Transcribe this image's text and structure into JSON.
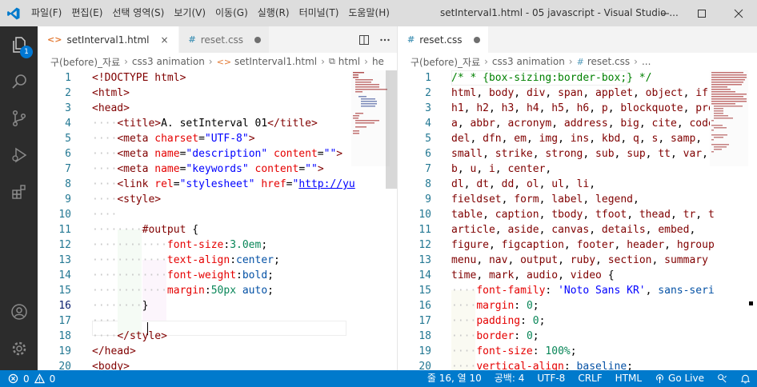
{
  "menu": [
    "파일(F)",
    "편집(E)",
    "선택 영역(S)",
    "보기(V)",
    "이동(G)",
    "실행(R)",
    "터미널(T)",
    "도움말(H)"
  ],
  "window_title": "setInterval1.html - 05 javascript - Visual Studio ...",
  "explorer_badge": "1",
  "left": {
    "tabs": [
      {
        "label": "setInterval1.html",
        "icon": "<>",
        "state": "active",
        "close": "×"
      },
      {
        "label": "reset.css",
        "icon": "#",
        "state": "inactive"
      }
    ],
    "breadcrumb": [
      "구(before)_자료",
      "css3 animation",
      "setInterval1.html",
      "html",
      "he"
    ],
    "lines": [
      {
        "n": "1",
        "html": "<span class=\"t-tag\">&lt;!DOCTYPE html&gt;</span>"
      },
      {
        "n": "2",
        "html": "<span class=\"t-tag\">&lt;html&gt;</span>"
      },
      {
        "n": "3",
        "html": "<span class=\"t-tag\">&lt;head&gt;</span>"
      },
      {
        "n": "4",
        "html": "<span class=\"t-dim\">····</span><span class=\"t-tag\">&lt;title&gt;</span>A. setInterval 01<span class=\"t-tag\">&lt;/title&gt;</span>"
      },
      {
        "n": "5",
        "html": "<span class=\"t-dim\">····</span><span class=\"t-tag\">&lt;meta</span> <span class=\"t-attr\">charset</span>=<span class=\"t-str\">\"UTF-8\"</span><span class=\"t-tag\">&gt;</span>"
      },
      {
        "n": "6",
        "html": "<span class=\"t-dim\">····</span><span class=\"t-tag\">&lt;meta</span> <span class=\"t-attr\">name</span>=<span class=\"t-str\">\"description\"</span> <span class=\"t-attr\">content</span>=<span class=\"t-str\">\"\"</span><span class=\"t-tag\">&gt;</span>"
      },
      {
        "n": "7",
        "html": "<span class=\"t-dim\">····</span><span class=\"t-tag\">&lt;meta</span> <span class=\"t-attr\">name</span>=<span class=\"t-str\">\"keywords\"</span> <span class=\"t-attr\">content</span>=<span class=\"t-str\">\"\"</span><span class=\"t-tag\">&gt;</span>"
      },
      {
        "n": "8",
        "html": "<span class=\"t-dim\">····</span><span class=\"t-tag\">&lt;link</span> <span class=\"t-attr\">rel</span>=<span class=\"t-str\">\"stylesheet\"</span> <span class=\"t-attr\">href</span>=<span class=\"t-str\">\"<span class=\"t-link\">http://yu</span></span>"
      },
      {
        "n": "9",
        "html": "<span class=\"t-dim\">····</span><span class=\"t-tag\">&lt;style&gt;</span>"
      },
      {
        "n": "10",
        "html": "<span class=\"t-dim\">····</span>"
      },
      {
        "n": "11",
        "html": "<span class=\"t-dim\">········</span><span class=\"t-sel\">#output</span> {"
      },
      {
        "n": "12",
        "html": "<span class=\"t-dim\">············</span><span class=\"t-prop\">font-size</span>:<span class=\"t-num\">3.0em</span>;"
      },
      {
        "n": "13",
        "html": "<span class=\"t-dim\">············</span><span class=\"t-prop\">text-align</span>:<span class=\"t-val\">center</span>;"
      },
      {
        "n": "14",
        "html": "<span class=\"t-dim\">············</span><span class=\"t-prop\">font-weight</span>:<span class=\"t-val\">bold</span>;"
      },
      {
        "n": "15",
        "html": "<span class=\"t-dim\">············</span><span class=\"t-prop\">margin</span>:<span class=\"t-num\">50px</span> <span class=\"t-val\">auto</span>;"
      },
      {
        "n": "16",
        "html": "<span class=\"t-dim\">········</span>}",
        "current": true
      },
      {
        "n": "17",
        "html": "<span class=\"t-dim\">····</span>"
      },
      {
        "n": "18",
        "html": "<span class=\"t-dim\">····</span><span class=\"t-tag\">&lt;/style&gt;</span>"
      },
      {
        "n": "19",
        "html": "<span class=\"t-tag\">&lt;/head&gt;</span>"
      },
      {
        "n": "20",
        "html": "<span class=\"t-tag\">&lt;body&gt;</span>"
      }
    ]
  },
  "right": {
    "tabs": [
      {
        "label": "reset.css",
        "icon": "#",
        "state": "active",
        "dirty": true
      }
    ],
    "breadcrumb": [
      "구(before)_자료",
      "css3 animation",
      "reset.css",
      "..."
    ],
    "lines": [
      {
        "n": "1",
        "html": "<span class=\"t-com\">/* * {box-sizing:border-box;} */</span>"
      },
      {
        "n": "2",
        "html": "<span class=\"t-sel\">html</span>, <span class=\"t-sel\">body</span>, <span class=\"t-sel\">div</span>, <span class=\"t-sel\">span</span>, <span class=\"t-sel\">applet</span>, <span class=\"t-sel\">object</span>, <span class=\"t-sel\">ifr</span>"
      },
      {
        "n": "3",
        "html": "<span class=\"t-sel\">h1</span>, <span class=\"t-sel\">h2</span>, <span class=\"t-sel\">h3</span>, <span class=\"t-sel\">h4</span>, <span class=\"t-sel\">h5</span>, <span class=\"t-sel\">h6</span>, <span class=\"t-sel\">p</span>, <span class=\"t-sel\">blockquote</span>, <span class=\"t-sel\">pre</span>"
      },
      {
        "n": "4",
        "html": "<span class=\"t-sel\">a</span>, <span class=\"t-sel\">abbr</span>, <span class=\"t-sel\">acronym</span>, <span class=\"t-sel\">address</span>, <span class=\"t-sel\">big</span>, <span class=\"t-sel\">cite</span>, <span class=\"t-sel\">code</span>"
      },
      {
        "n": "5",
        "html": "<span class=\"t-sel\">del</span>, <span class=\"t-sel\">dfn</span>, <span class=\"t-sel\">em</span>, <span class=\"t-sel\">img</span>, <span class=\"t-sel\">ins</span>, <span class=\"t-sel\">kbd</span>, <span class=\"t-sel\">q</span>, <span class=\"t-sel\">s</span>, <span class=\"t-sel\">samp</span>,"
      },
      {
        "n": "6",
        "html": "<span class=\"t-sel\">small</span>, <span class=\"t-sel\">strike</span>, <span class=\"t-sel\">strong</span>, <span class=\"t-sel\">sub</span>, <span class=\"t-sel\">sup</span>, <span class=\"t-sel\">tt</span>, <span class=\"t-sel\">var</span>,"
      },
      {
        "n": "7",
        "html": "<span class=\"t-sel\">b</span>, <span class=\"t-sel\">u</span>, <span class=\"t-sel\">i</span>, <span class=\"t-sel\">center</span>,"
      },
      {
        "n": "8",
        "html": "<span class=\"t-sel\">dl</span>, <span class=\"t-sel\">dt</span>, <span class=\"t-sel\">dd</span>, <span class=\"t-sel\">ol</span>, <span class=\"t-sel\">ul</span>, <span class=\"t-sel\">li</span>,"
      },
      {
        "n": "9",
        "html": "<span class=\"t-sel\">fieldset</span>, <span class=\"t-sel\">form</span>, <span class=\"t-sel\">label</span>, <span class=\"t-sel\">legend</span>,"
      },
      {
        "n": "10",
        "html": "<span class=\"t-sel\">table</span>, <span class=\"t-sel\">caption</span>, <span class=\"t-sel\">tbody</span>, <span class=\"t-sel\">tfoot</span>, <span class=\"t-sel\">thead</span>, <span class=\"t-sel\">tr</span>, <span class=\"t-sel\">t</span>"
      },
      {
        "n": "11",
        "html": "<span class=\"t-sel\">article</span>, <span class=\"t-sel\">aside</span>, <span class=\"t-sel\">canvas</span>, <span class=\"t-sel\">details</span>, <span class=\"t-sel\">embed</span>,"
      },
      {
        "n": "12",
        "html": "<span class=\"t-sel\">figure</span>, <span class=\"t-sel\">figcaption</span>, <span class=\"t-sel\">footer</span>, <span class=\"t-sel\">header</span>, <span class=\"t-sel\">hgroup</span>"
      },
      {
        "n": "13",
        "html": "<span class=\"t-sel\">menu</span>, <span class=\"t-sel\">nav</span>, <span class=\"t-sel\">output</span>, <span class=\"t-sel\">ruby</span>, <span class=\"t-sel\">section</span>, <span class=\"t-sel\">summary</span>"
      },
      {
        "n": "14",
        "html": "<span class=\"t-sel\">time</span>, <span class=\"t-sel\">mark</span>, <span class=\"t-sel\">audio</span>, <span class=\"t-sel\">video</span> {"
      },
      {
        "n": "15",
        "html": "<span class=\"t-dim\">····</span><span class=\"t-prop\">font-family</span>: <span class=\"t-str\">'Noto Sans KR'</span>, <span class=\"t-val\">sans-seri</span>"
      },
      {
        "n": "16",
        "html": "<span class=\"t-dim\">····</span><span class=\"t-prop\">margin</span>: <span class=\"t-num\">0</span>;"
      },
      {
        "n": "17",
        "html": "<span class=\"t-dim\">····</span><span class=\"t-prop\">padding</span>: <span class=\"t-num\">0</span>;"
      },
      {
        "n": "18",
        "html": "<span class=\"t-dim\">····</span><span class=\"t-prop\">border</span>: <span class=\"t-num\">0</span>;"
      },
      {
        "n": "19",
        "html": "<span class=\"t-dim\">····</span><span class=\"t-prop\">font-size</span>: <span class=\"t-num\">100%</span>;"
      },
      {
        "n": "20",
        "html": "<span class=\"t-dim\">····</span><span class=\"t-prop\">vertical-align</span>: <span class=\"t-val\">baseline</span>;"
      }
    ]
  },
  "status": {
    "errors": "0",
    "warnings": "0",
    "position": "줄 16, 열 10",
    "spaces": "공백: 4",
    "encoding": "UTF-8",
    "eol": "CRLF",
    "language": "HTML",
    "live": "Go Live"
  },
  "colors": {
    "accent": "#007acc",
    "activity_bar": "#2c2c2c",
    "title_bar": "#dddddd"
  }
}
